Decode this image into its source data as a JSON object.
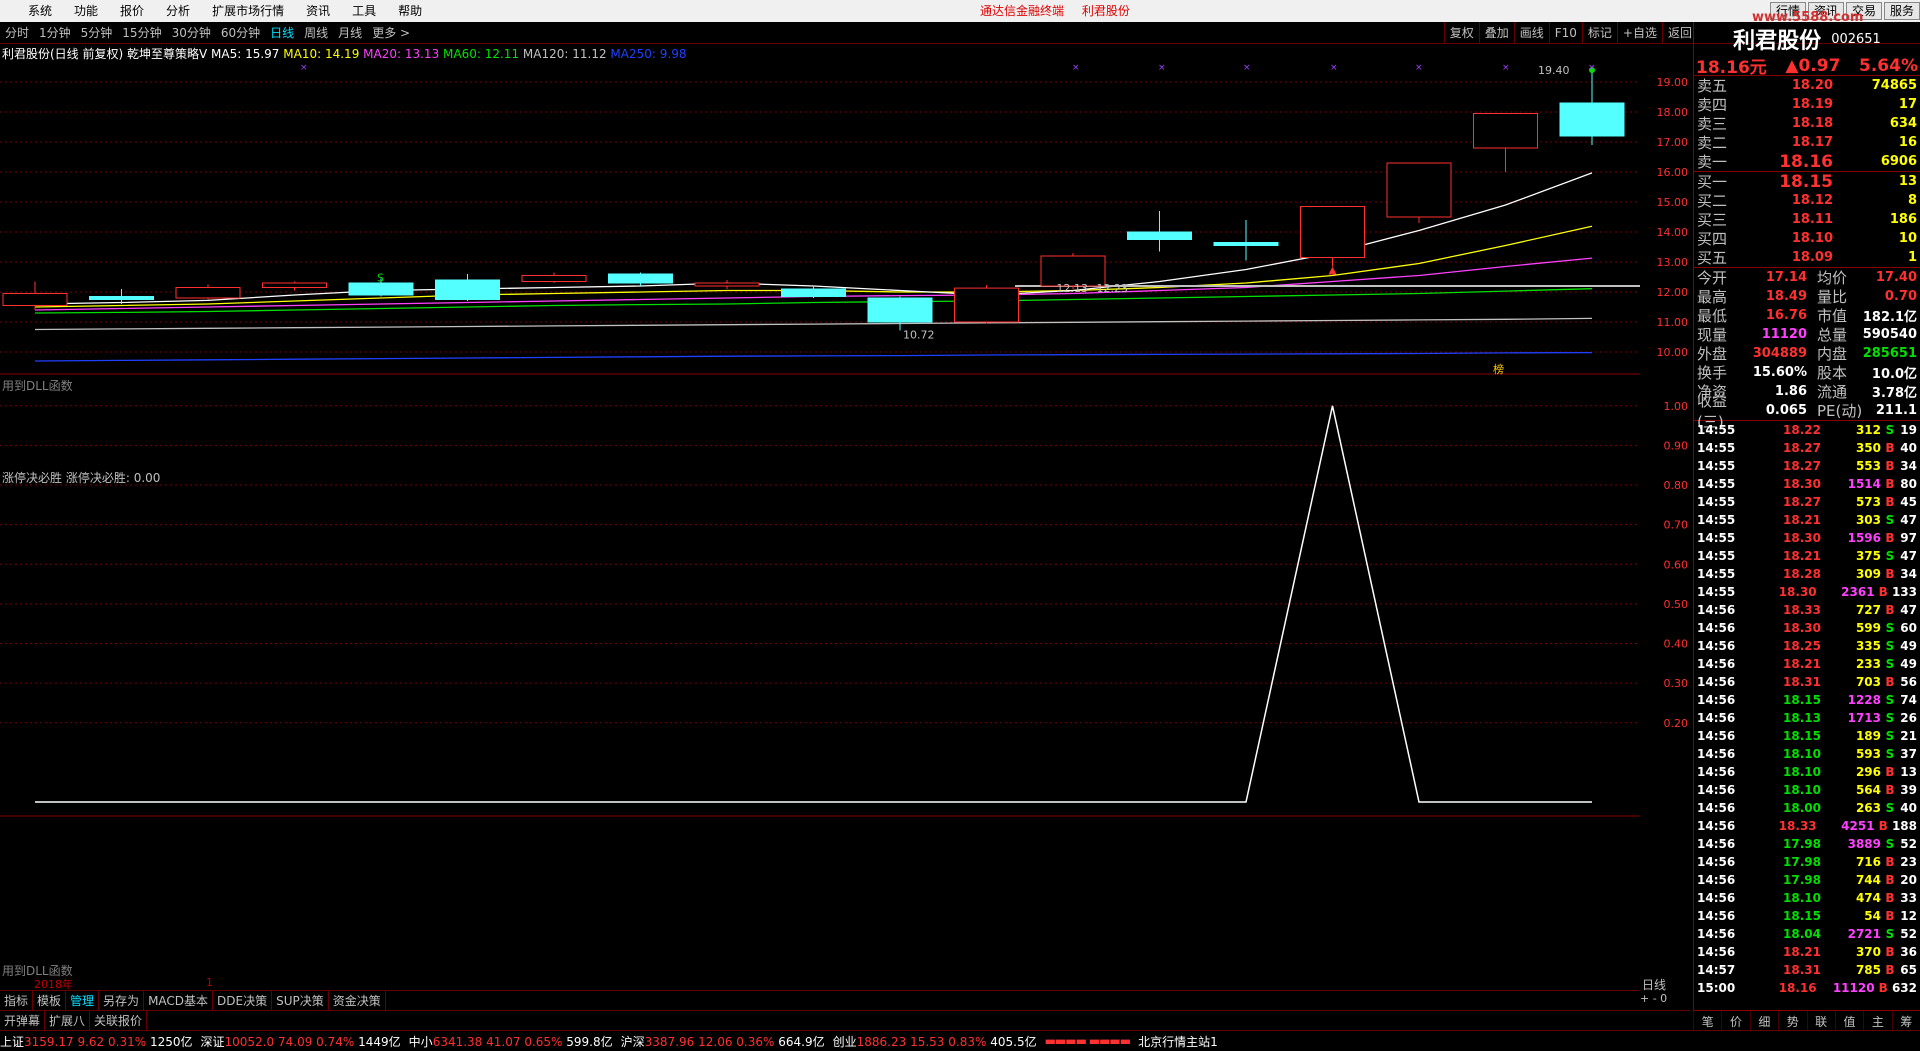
{
  "menu": {
    "items": [
      "系统",
      "功能",
      "报价",
      "分析",
      "扩展市场行情",
      "资讯",
      "工具",
      "帮助"
    ],
    "title_left": "通达信金融终端",
    "title_right": "利君股份",
    "right_buttons": [
      "行情",
      "资讯",
      "交易",
      "服务"
    ],
    "watermark": "www.5588.com"
  },
  "periods": [
    "分时",
    "1分钟",
    "5分钟",
    "15分钟",
    "30分钟",
    "60分钟",
    "日线",
    "周线",
    "月线",
    "更多 >"
  ],
  "active_period": "日线",
  "chart_buttons": [
    "复权",
    "叠加",
    "画线",
    "F10",
    "标记",
    "+自选",
    "返回"
  ],
  "kline": {
    "legend": {
      "title": "利君股份(日线 前复权) 乾坤至尊策略V",
      "ma5": "MA5: 15.97",
      "ma10": "MA10: 14.19",
      "ma20": "MA20: 13.13",
      "ma60": "MA60: 12.11",
      "ma120": "MA120: 11.12",
      "ma250": "MA250: 9.98"
    },
    "annotations": {
      "high": "19.40",
      "low": "10.72",
      "mid1": "12.13",
      "mid2": "12.23",
      "s_mark": "S",
      "bang": "榜"
    },
    "y_ticks": [
      "19.00",
      "18.00",
      "17.00",
      "16.00",
      "15.00",
      "14.00",
      "13.00",
      "12.00",
      "11.00",
      "10.00"
    ],
    "dll": "用到DLL函数",
    "colors": {
      "up": "#ff3030",
      "down": "#54ffff",
      "ma5": "#ffffff",
      "ma10": "#ffff00",
      "ma20": "#ff40ff",
      "ma60": "#00e000",
      "ma120": "#c0c0c0",
      "ma250": "#2040ff"
    }
  },
  "chart_data": [
    {
      "type": "candlestick",
      "ylim": [
        9.6,
        19.8
      ],
      "y_ticks": [
        19,
        18,
        17,
        16,
        15,
        14,
        13,
        12,
        11,
        10
      ],
      "candles": [
        {
          "o": 11.55,
          "c": 11.95,
          "h": 12.35,
          "l": 11.4
        },
        {
          "o": 11.85,
          "c": 11.75,
          "h": 12.1,
          "l": 11.6
        },
        {
          "o": 11.8,
          "c": 12.15,
          "h": 12.25,
          "l": 11.75
        },
        {
          "o": 12.15,
          "c": 12.3,
          "h": 12.35,
          "l": 12.05
        },
        {
          "o": 12.3,
          "c": 11.9,
          "h": 12.45,
          "l": 11.85
        },
        {
          "o": 12.4,
          "c": 11.75,
          "h": 12.6,
          "l": 11.7
        },
        {
          "o": 12.35,
          "c": 12.55,
          "h": 12.65,
          "l": 12.3
        },
        {
          "o": 12.6,
          "c": 12.3,
          "h": 12.65,
          "l": 12.2
        },
        {
          "o": 12.2,
          "c": 12.3,
          "h": 12.4,
          "l": 12.1
        },
        {
          "o": 12.1,
          "c": 11.85,
          "h": 12.2,
          "l": 11.8
        },
        {
          "o": 11.8,
          "c": 11.0,
          "h": 11.85,
          "l": 10.72
        },
        {
          "o": 11.0,
          "c": 12.13,
          "h": 12.23,
          "l": 10.95
        },
        {
          "o": 12.2,
          "c": 13.2,
          "h": 13.3,
          "l": 12.1
        },
        {
          "o": 14.0,
          "c": 13.75,
          "h": 14.7,
          "l": 13.35
        },
        {
          "o": 13.65,
          "c": 13.55,
          "h": 14.4,
          "l": 13.05
        },
        {
          "o": 13.15,
          "c": 14.85,
          "h": 14.85,
          "l": 12.85
        },
        {
          "o": 14.5,
          "c": 16.3,
          "h": 16.3,
          "l": 14.3
        },
        {
          "o": 16.8,
          "c": 17.95,
          "h": 17.95,
          "l": 16.0
        },
        {
          "o": 18.3,
          "c": 17.2,
          "h": 19.4,
          "l": 16.9
        }
      ],
      "ma5": [
        11.6,
        11.65,
        11.72,
        11.9,
        12.05,
        12.1,
        12.15,
        12.2,
        12.3,
        12.2,
        12.05,
        11.9,
        12.05,
        12.35,
        12.75,
        13.3,
        14.05,
        14.9,
        15.97
      ],
      "ma10": [
        11.5,
        11.55,
        11.6,
        11.7,
        11.8,
        11.9,
        11.95,
        12.0,
        12.05,
        12.05,
        12.0,
        12.0,
        12.05,
        12.15,
        12.3,
        12.55,
        12.95,
        13.55,
        14.19
      ],
      "ma20": [
        11.4,
        11.45,
        11.5,
        11.55,
        11.6,
        11.65,
        11.7,
        11.75,
        11.8,
        11.85,
        11.88,
        11.9,
        11.95,
        12.05,
        12.15,
        12.35,
        12.55,
        12.85,
        13.13
      ],
      "ma60": [
        11.3,
        11.32,
        11.35,
        11.4,
        11.45,
        11.5,
        11.55,
        11.58,
        11.6,
        11.65,
        11.68,
        11.7,
        11.75,
        11.8,
        11.85,
        11.9,
        11.95,
        12.03,
        12.11
      ],
      "ma120": [
        10.75,
        10.77,
        10.79,
        10.81,
        10.83,
        10.85,
        10.87,
        10.89,
        10.91,
        10.93,
        10.95,
        10.97,
        10.99,
        11.01,
        11.03,
        11.05,
        11.07,
        11.09,
        11.12
      ],
      "ma250": [
        9.7,
        9.72,
        9.74,
        9.76,
        9.78,
        9.8,
        9.82,
        9.84,
        9.86,
        9.87,
        9.88,
        9.9,
        9.91,
        9.92,
        9.93,
        9.94,
        9.95,
        9.97,
        9.98
      ]
    },
    {
      "type": "line",
      "title": "涨停决必胜",
      "ylim": [
        0,
        1.05
      ],
      "y_ticks": [
        "1.00",
        "0.90",
        "0.80",
        "0.70",
        "0.60",
        "0.50",
        "0.40",
        "0.30",
        "0.20"
      ],
      "series": [
        {
          "name": "涨停决必胜",
          "values": [
            0,
            0,
            0,
            0,
            0,
            0,
            0,
            0,
            0,
            0,
            0,
            0,
            0,
            0,
            0,
            1,
            0,
            0,
            0
          ]
        }
      ]
    }
  ],
  "indicator": {
    "legend_name": "涨停决必胜",
    "legend_value": "涨停决必胜: 0.00",
    "dll": "用到DLL函数"
  },
  "year_label": "2018年",
  "year_tick": "1",
  "daily_label": "日线",
  "zoom": "+ - 0",
  "stock": {
    "name": "利君股份",
    "code": "002651",
    "price": "18.16元",
    "change": "▲0.97",
    "pct": "5.64%"
  },
  "orderbook": {
    "asks": [
      {
        "l": "卖五",
        "p": "18.20",
        "v": "74865"
      },
      {
        "l": "卖四",
        "p": "18.19",
        "v": "17"
      },
      {
        "l": "卖三",
        "p": "18.18",
        "v": "634"
      },
      {
        "l": "卖二",
        "p": "18.17",
        "v": "16"
      },
      {
        "l": "卖一",
        "p": "18.16",
        "v": "6906"
      }
    ],
    "bids": [
      {
        "l": "买一",
        "p": "18.15",
        "v": "13"
      },
      {
        "l": "买二",
        "p": "18.12",
        "v": "8"
      },
      {
        "l": "买三",
        "p": "18.11",
        "v": "186"
      },
      {
        "l": "买四",
        "p": "18.10",
        "v": "10"
      },
      {
        "l": "买五",
        "p": "18.09",
        "v": "1"
      }
    ]
  },
  "stats": [
    {
      "k": "今开",
      "v": "17.14",
      "c1": "red",
      "k2": "均价",
      "v2": "17.40",
      "c2": "red"
    },
    {
      "k": "最高",
      "v": "18.49",
      "c1": "red",
      "k2": "量比",
      "v2": "0.70",
      "c2": "red"
    },
    {
      "k": "最低",
      "v": "16.76",
      "c1": "red",
      "k2": "市值",
      "v2": "182.1亿",
      "c2": "wht"
    },
    {
      "k": "现量",
      "v": "11120",
      "c1": "mag",
      "k2": "总量",
      "v2": "590540",
      "c2": "wht"
    },
    {
      "k": "外盘",
      "v": "304889",
      "c1": "red",
      "k2": "内盘",
      "v2": "285651",
      "c2": "green"
    },
    {
      "k": "换手",
      "v": "15.60%",
      "c1": "wht",
      "k2": "股本",
      "v2": "10.0亿",
      "c2": "wht"
    },
    {
      "k": "净资",
      "v": "1.86",
      "c1": "wht",
      "k2": "流通",
      "v2": "3.78亿",
      "c2": "wht"
    },
    {
      "k": "收益(三)",
      "v": "0.065",
      "c1": "wht",
      "k2": "PE(动)",
      "v2": "211.1",
      "c2": "wht"
    }
  ],
  "ticks": [
    {
      "t": "14:55",
      "p": "18.22",
      "v": "312",
      "s": "S",
      "n": "19"
    },
    {
      "t": "14:55",
      "p": "18.27",
      "v": "350",
      "s": "B",
      "n": "40"
    },
    {
      "t": "14:55",
      "p": "18.27",
      "v": "553",
      "s": "B",
      "n": "34"
    },
    {
      "t": "14:55",
      "p": "18.30",
      "v": "1514",
      "s": "B",
      "n": "80"
    },
    {
      "t": "14:55",
      "p": "18.27",
      "v": "573",
      "s": "B",
      "n": "45"
    },
    {
      "t": "14:55",
      "p": "18.21",
      "v": "303",
      "s": "S",
      "n": "47"
    },
    {
      "t": "14:55",
      "p": "18.30",
      "v": "1596",
      "s": "B",
      "n": "97"
    },
    {
      "t": "14:55",
      "p": "18.21",
      "v": "375",
      "s": "S",
      "n": "47"
    },
    {
      "t": "14:55",
      "p": "18.28",
      "v": "309",
      "s": "B",
      "n": "34"
    },
    {
      "t": "14:55",
      "p": "18.30",
      "v": "2361",
      "s": "B",
      "n": "133"
    },
    {
      "t": "14:56",
      "p": "18.33",
      "v": "727",
      "s": "B",
      "n": "47"
    },
    {
      "t": "14:56",
      "p": "18.30",
      "v": "599",
      "s": "S",
      "n": "60"
    },
    {
      "t": "14:56",
      "p": "18.25",
      "v": "335",
      "s": "S",
      "n": "49"
    },
    {
      "t": "14:56",
      "p": "18.21",
      "v": "233",
      "s": "S",
      "n": "49"
    },
    {
      "t": "14:56",
      "p": "18.31",
      "v": "703",
      "s": "B",
      "n": "56"
    },
    {
      "t": "14:56",
      "p": "18.15",
      "v": "1228",
      "s": "S",
      "n": "74"
    },
    {
      "t": "14:56",
      "p": "18.13",
      "v": "1713",
      "s": "S",
      "n": "26"
    },
    {
      "t": "14:56",
      "p": "18.15",
      "v": "189",
      "s": "S",
      "n": "21"
    },
    {
      "t": "14:56",
      "p": "18.10",
      "v": "593",
      "s": "S",
      "n": "37"
    },
    {
      "t": "14:56",
      "p": "18.10",
      "v": "296",
      "s": "B",
      "n": "13"
    },
    {
      "t": "14:56",
      "p": "18.10",
      "v": "564",
      "s": "B",
      "n": "39"
    },
    {
      "t": "14:56",
      "p": "18.00",
      "v": "263",
      "s": "S",
      "n": "40"
    },
    {
      "t": "14:56",
      "p": "18.33",
      "v": "4251",
      "s": "B",
      "n": "188"
    },
    {
      "t": "14:56",
      "p": "17.98",
      "v": "3889",
      "s": "S",
      "n": "52"
    },
    {
      "t": "14:56",
      "p": "17.98",
      "v": "716",
      "s": "B",
      "n": "23"
    },
    {
      "t": "14:56",
      "p": "17.98",
      "v": "744",
      "s": "B",
      "n": "20"
    },
    {
      "t": "14:56",
      "p": "18.10",
      "v": "474",
      "s": "B",
      "n": "33"
    },
    {
      "t": "14:56",
      "p": "18.15",
      "v": "54",
      "s": "B",
      "n": "12"
    },
    {
      "t": "14:56",
      "p": "18.04",
      "v": "2721",
      "s": "S",
      "n": "52"
    },
    {
      "t": "14:56",
      "p": "18.21",
      "v": "370",
      "s": "B",
      "n": "36"
    },
    {
      "t": "14:57",
      "p": "18.31",
      "v": "785",
      "s": "B",
      "n": "65"
    },
    {
      "t": "15:00",
      "p": "18.16",
      "v": "11120",
      "s": "B",
      "n": "632"
    }
  ],
  "right_tabs": [
    "笔",
    "价",
    "细",
    "势",
    "联",
    "值",
    "主",
    "筹"
  ],
  "bottom_tabs1": [
    "指标",
    "模板",
    "管理",
    "另存为",
    "MACD基本",
    "DDE决策",
    "SUP决策",
    "资金决策"
  ],
  "bottom_tabs2": [
    "开弹幕",
    "扩展八",
    "关联报价"
  ],
  "status": {
    "sh": {
      "name": "上证",
      "v": "3159.17",
      "c": "9.62",
      "p": "0.31%",
      "amt": "1250亿"
    },
    "sz": {
      "name": "深证",
      "v": "10052.0",
      "c": "74.09",
      "p": "0.74%",
      "amt": "1449亿"
    },
    "zx": {
      "name": "中小",
      "v": "6341.38",
      "c": "41.07",
      "p": "0.65%",
      "amt": "599.8亿"
    },
    "hs": {
      "name": "沪深",
      "v": "3387.96",
      "c": "12.06",
      "p": "0.36%",
      "amt": "664.9亿"
    },
    "cy": {
      "name": "创业",
      "v": "1886.23",
      "c": "15.53",
      "p": "0.83%",
      "amt": "405.5亿"
    },
    "server": "北京行情主站1"
  }
}
